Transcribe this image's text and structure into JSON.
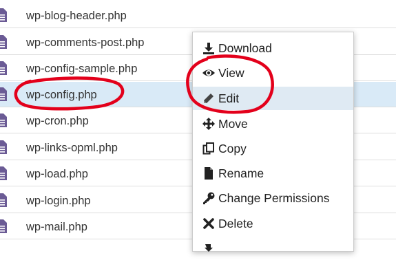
{
  "files": [
    {
      "name": "wp-blog-header.php",
      "icon": "file-text-icon"
    },
    {
      "name": "wp-comments-post.php",
      "icon": "file-text-icon"
    },
    {
      "name": "wp-config-sample.php",
      "icon": "file-text-icon"
    },
    {
      "name": "wp-config.php",
      "icon": "file-text-icon",
      "selected": true
    },
    {
      "name": "wp-cron.php",
      "icon": "file-text-icon"
    },
    {
      "name": "wp-links-opml.php",
      "icon": "file-text-icon"
    },
    {
      "name": "wp-load.php",
      "icon": "file-text-icon"
    },
    {
      "name": "wp-login.php",
      "icon": "file-text-icon"
    },
    {
      "name": "wp-mail.php",
      "icon": "file-text-icon"
    }
  ],
  "context_menu": {
    "items": [
      {
        "label": "Download",
        "icon": "download-icon"
      },
      {
        "label": "View",
        "icon": "eye-icon"
      },
      {
        "label": "Edit",
        "icon": "pencil-icon",
        "active": true
      },
      {
        "label": "Move",
        "icon": "move-arrows-icon"
      },
      {
        "label": "Copy",
        "icon": "copy-icon"
      },
      {
        "label": "Rename",
        "icon": "file-icon"
      },
      {
        "label": "Change Permissions",
        "icon": "key-icon"
      },
      {
        "label": "Delete",
        "icon": "close-icon"
      }
    ]
  },
  "colors": {
    "selected_row": "#d9eaf7",
    "file_icon": "#6b5b95",
    "annotation": "#e3001b"
  }
}
